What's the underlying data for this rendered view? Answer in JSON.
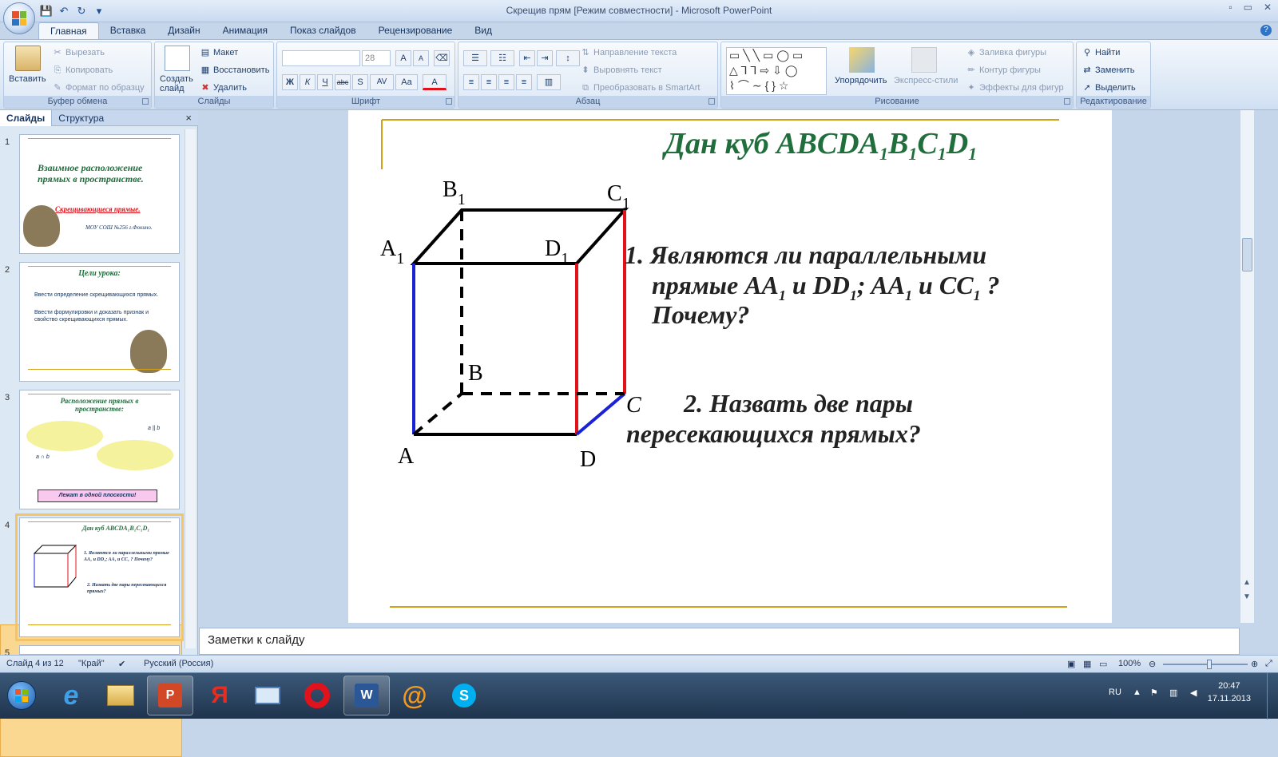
{
  "window": {
    "title": "Скрещив прям [Режим совместности] - Microsoft PowerPoint",
    "controls": [
      "▫",
      "▭",
      "✕"
    ]
  },
  "qat": {
    "save": "💾",
    "undo": "↶",
    "redo": "↻",
    "more": "▾"
  },
  "tabs": [
    "Главная",
    "Вставка",
    "Дизайн",
    "Анимация",
    "Показ слайдов",
    "Рецензирование",
    "Вид"
  ],
  "ribbon": {
    "clipboard": {
      "label": "Буфер обмена",
      "paste": "Вставить",
      "cut": "Вырезать",
      "copy": "Копировать",
      "format_painter": "Формат по образцу"
    },
    "slides": {
      "label": "Слайды",
      "create": "Создать слайд",
      "layout": "Макет",
      "reset": "Восстановить",
      "delete": "Удалить"
    },
    "font": {
      "label": "Шрифт",
      "size": "28",
      "bold": "Ж",
      "italic": "К",
      "underline": "Ч",
      "strike": "abc",
      "shadow": "S",
      "spacing": "AV",
      "case": "Aa",
      "color": "A",
      "grow": "A",
      "shrink": "A"
    },
    "paragraph": {
      "label": "Абзац",
      "text_direction": "Направление текста",
      "align_text": "Выровнять текст",
      "smartart": "Преобразовать в SmartArt"
    },
    "drawing": {
      "label": "Рисование",
      "arrange": "Упорядочить",
      "quick_styles": "Экспресс-стили",
      "shape_fill": "Заливка фигуры",
      "shape_outline": "Контур фигуры",
      "shape_effects": "Эффекты для фигур"
    },
    "editing": {
      "label": "Редактирование",
      "find": "Найти",
      "replace": "Заменить",
      "select": "Выделить"
    }
  },
  "pane": {
    "tab_slides": "Слайды",
    "tab_outline": "Структура",
    "close": "×",
    "thumbs": [
      {
        "num": "1",
        "title": "Взаимное расположение прямых в пространстве.",
        "subtitle": "Скрещивающиеся прямые.",
        "author": "МОУ СОШ №256 г.Фокино."
      },
      {
        "num": "2",
        "title": "Цели урока:",
        "items": [
          "Ввести определение скрещивающихся прямых.",
          "Ввести формулировки и доказать признак и свойство скрещивающихся прямых."
        ]
      },
      {
        "num": "3",
        "title": "Расположение прямых в пространстве:",
        "caption": "Лежат в одной плоскости!",
        "l1": "a || b",
        "l2": "a ∩ b"
      },
      {
        "num": "4",
        "title": "Дан куб ABCDA₁B₁C₁D₁",
        "q1": "1. Являются ли параллельными прямые AA₁ и DD₁; AA₁ и CC₁ ? Почему?",
        "q2": "2. Назвать две пары пересекающихся прямых?"
      },
      {
        "num": "5"
      }
    ]
  },
  "slide": {
    "title_main": "Дан куб ABCDA",
    "title_sub": [
      "1",
      "B",
      "1",
      "C",
      "1",
      "D",
      "1"
    ],
    "vertices": {
      "A": "A",
      "B": "B",
      "C": "C",
      "D": "D",
      "A1": "A",
      "B1": "B",
      "C1": "C",
      "D1": "D",
      "sub": "1"
    },
    "q1_lines": [
      "1. Являются ли параллельными",
      "прямые AA",
      "1",
      " и DD",
      "1",
      "; AA",
      "1",
      " и CC",
      "1",
      " ?",
      "Почему?"
    ],
    "q2_lines": [
      "2. Назвать две пары",
      "пересекающихся прямых?"
    ]
  },
  "notes_placeholder": "Заметки к слайду",
  "status": {
    "slide_counter": "Слайд 4 из 12",
    "theme": "\"Край\"",
    "language": "Русский (Россия)",
    "zoom": "100%",
    "zoom_level": 0.55
  },
  "taskbar": {
    "lang": "RU",
    "time": "20:47",
    "date": "17.11.2013"
  },
  "colors": {
    "title_green": "#1f6e3c",
    "red_edge": "#e2121b",
    "blue_edge": "#1a22d6",
    "gold_line": "#d4a017"
  }
}
